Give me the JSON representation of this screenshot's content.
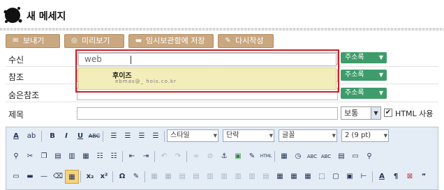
{
  "header": {
    "title": "새 메세지"
  },
  "toolbar": {
    "send": "보내기",
    "preview": "미리보기",
    "save_draft": "임시보관함에 저장",
    "rewrite": "다시작성"
  },
  "form": {
    "to_label": "수신",
    "cc_label": "참조",
    "bcc_label": "숨은참조",
    "subject_label": "제목",
    "address_book": "주소록",
    "to_value": "web",
    "suggestion": {
      "name": "후이즈",
      "email": "ebmas@_ hois.co.kr"
    },
    "priority": "보통",
    "html_label": "HTML 사용",
    "html_checked": true
  },
  "editor": {
    "style": "스타일",
    "paragraph": "단락",
    "font": "글꼴",
    "size": "2 (9 pt)"
  }
}
